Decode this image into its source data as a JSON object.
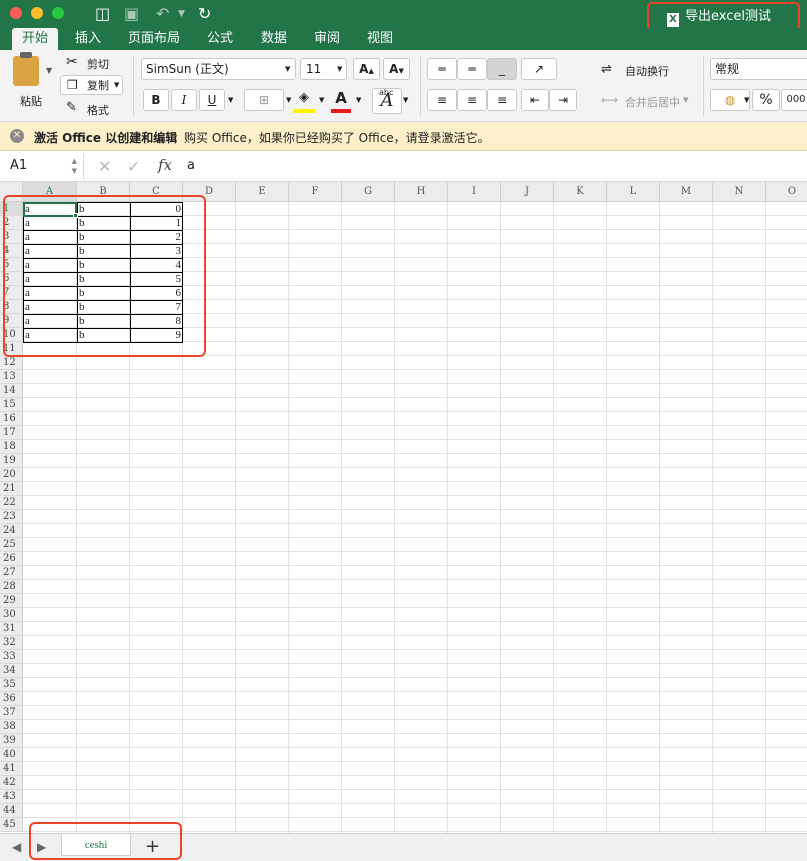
{
  "titlebar": {
    "export_label": "导出excel测试",
    "export_icon": "excel-file-icon"
  },
  "ribbon_tabs": [
    "开始",
    "插入",
    "页面布局",
    "公式",
    "数据",
    "审阅",
    "视图"
  ],
  "clipboard": {
    "paste": "粘贴",
    "cut": "剪切",
    "copy": "复制",
    "format": "格式"
  },
  "font": {
    "name": "SimSun (正文)",
    "size": "11",
    "bold": "B",
    "italic": "I",
    "underline": "U"
  },
  "alignment": {
    "wrap_text": "自动换行",
    "merge_center": "合并后居中"
  },
  "number": {
    "format": "常规",
    "percent": "%",
    "thousands": "000"
  },
  "message": {
    "bold_text": "激活 Office 以创建和编辑",
    "text": "购买 Office，如果你已经购买了 Office，请登录激活它。"
  },
  "formula_bar": {
    "name_box": "A1",
    "fx": "fx",
    "value": "a"
  },
  "columns": [
    "A",
    "B",
    "C",
    "D",
    "E",
    "F",
    "G",
    "H",
    "I",
    "J",
    "K",
    "L",
    "M",
    "N",
    "O"
  ],
  "rows": [
    "1",
    "2",
    "3",
    "4",
    "5",
    "6",
    "7",
    "8",
    "9",
    "10",
    "11",
    "12",
    "13",
    "14",
    "15",
    "16",
    "17",
    "18",
    "19",
    "20",
    "21",
    "22",
    "23",
    "24",
    "25",
    "26",
    "27",
    "28",
    "29",
    "30",
    "31",
    "32",
    "33",
    "34",
    "35",
    "36",
    "37",
    "38",
    "39",
    "40",
    "41",
    "42",
    "43",
    "44",
    "45"
  ],
  "table": [
    {
      "a": "a",
      "b": "b",
      "c": "0"
    },
    {
      "a": "a",
      "b": "b",
      "c": "1"
    },
    {
      "a": "a",
      "b": "b",
      "c": "2"
    },
    {
      "a": "a",
      "b": "b",
      "c": "3"
    },
    {
      "a": "a",
      "b": "b",
      "c": "4"
    },
    {
      "a": "a",
      "b": "b",
      "c": "5"
    },
    {
      "a": "a",
      "b": "b",
      "c": "6"
    },
    {
      "a": "a",
      "b": "b",
      "c": "7"
    },
    {
      "a": "a",
      "b": "b",
      "c": "8"
    },
    {
      "a": "a",
      "b": "b",
      "c": "9"
    }
  ],
  "sheet": {
    "name": "ceshi",
    "add": "+"
  },
  "colors": {
    "accent": "#227547",
    "highlight": "#e8452c",
    "message_bg": "#fcefc9"
  }
}
